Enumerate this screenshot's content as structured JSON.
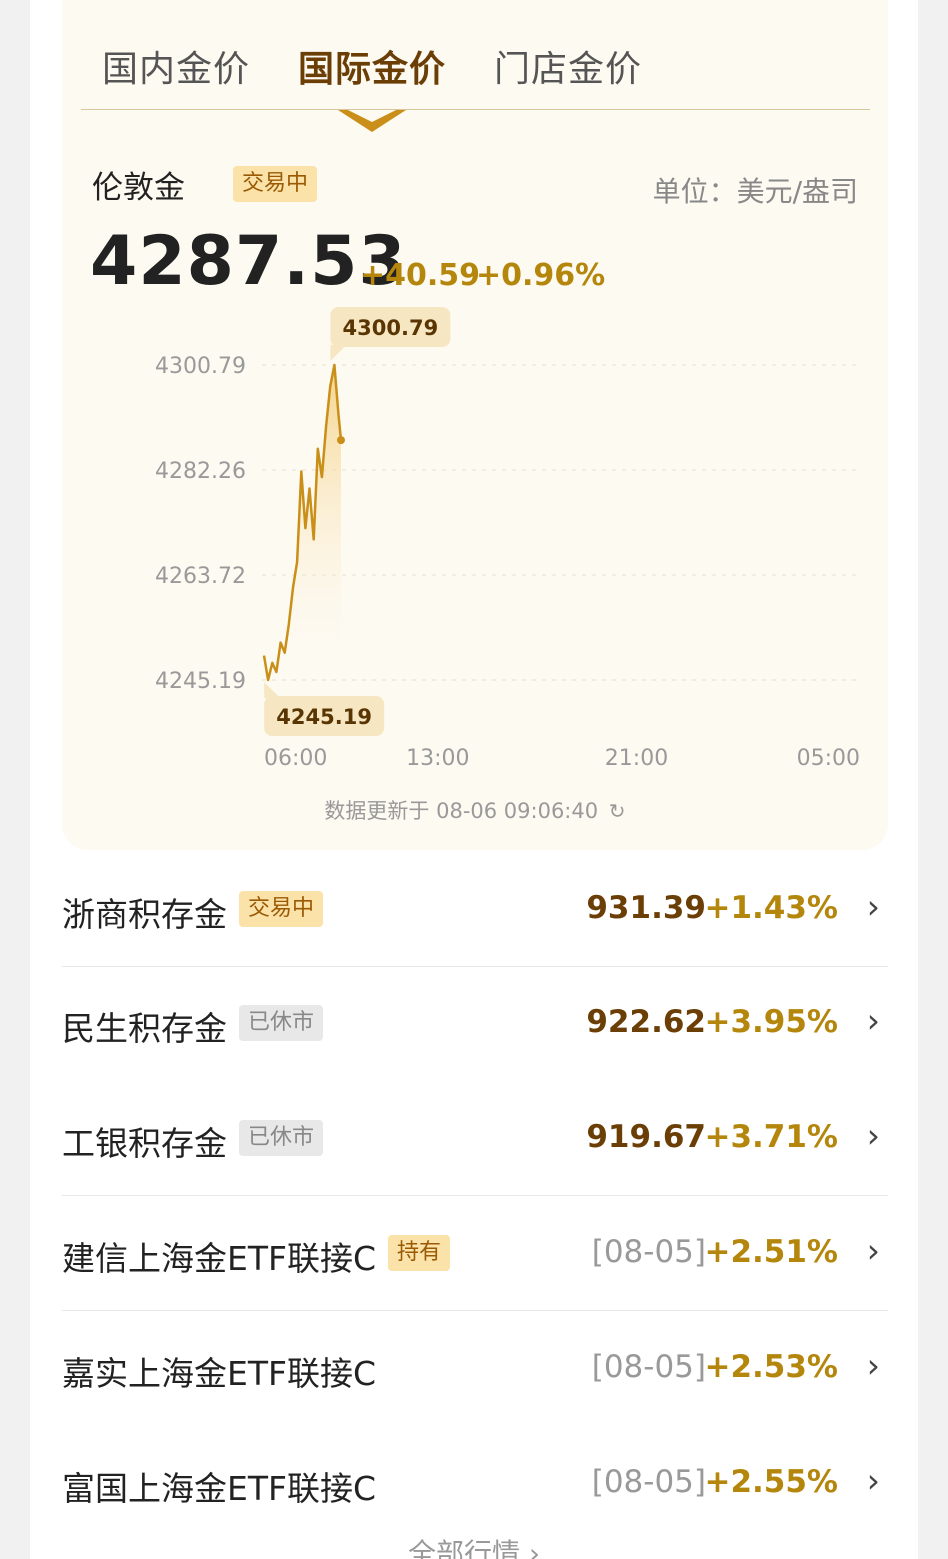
{
  "tabs": [
    {
      "label": "国内金价",
      "active": false
    },
    {
      "label": "国际金价",
      "active": true
    },
    {
      "label": "门店金价",
      "active": false
    }
  ],
  "asset": {
    "name": "伦敦金",
    "status": "交易中",
    "unit_label": "单位：美元/盎司",
    "price": "4287.53",
    "change": "+40.59",
    "change_pct": "+0.96%",
    "update_text": "数据更新于 08-06 09:06:40"
  },
  "colors": {
    "accent": "#c98f18",
    "up": "#b4860c",
    "brown": "#6b3e06"
  },
  "chart_data": {
    "type": "line",
    "series": [
      {
        "x": [
          "06:00",
          "06:10",
          "06:20",
          "06:30",
          "06:40",
          "06:50",
          "07:00",
          "07:10",
          "07:20",
          "07:30",
          "07:40",
          "07:50",
          "08:00",
          "08:10",
          "08:20",
          "08:30",
          "08:40",
          "08:50",
          "09:00",
          "09:06"
        ],
        "values": [
          4249.5,
          4245.19,
          4248.2,
          4246.6,
          4251.8,
          4250.0,
          4255.0,
          4261.5,
          4266.0,
          4282.0,
          4272.0,
          4279.0,
          4270.0,
          4286.0,
          4281.0,
          4290.0,
          4297.0,
          4300.79,
          4292.0,
          4287.53
        ]
      }
    ],
    "ylim": [
      4245.19,
      4300.79
    ],
    "y_ticks": [
      "4300.79",
      "4282.26",
      "4263.72",
      "4245.19"
    ],
    "x_ticks": [
      "06:00",
      "13:00",
      "21:00",
      "05:00"
    ],
    "max_label": "4300.79",
    "min_label": "4245.19",
    "grid": true
  },
  "rows": [
    {
      "name": "浙商积存金",
      "badge": "交易中",
      "badge_type": "trading",
      "value": "931.39",
      "value_is_date": false,
      "pct": "+1.43%",
      "divider": true
    },
    {
      "name": "民生积存金",
      "badge": "已休市",
      "badge_type": "closed",
      "value": "922.62",
      "value_is_date": false,
      "pct": "+3.95%",
      "divider": false
    },
    {
      "name": "工银积存金",
      "badge": "已休市",
      "badge_type": "closed",
      "value": "919.67",
      "value_is_date": false,
      "pct": "+3.71%",
      "divider": true
    },
    {
      "name": "建信上海金ETF联接C",
      "badge": "持有",
      "badge_type": "trading",
      "value": "[08-05]",
      "value_is_date": true,
      "pct": "+2.51%",
      "divider": true
    },
    {
      "name": "嘉实上海金ETF联接C",
      "badge": "",
      "badge_type": "",
      "value": "[08-05]",
      "value_is_date": true,
      "pct": "+2.53%",
      "divider": false
    },
    {
      "name": "富国上海金ETF联接C",
      "badge": "",
      "badge_type": "",
      "value": "[08-05]",
      "value_is_date": true,
      "pct": "+2.55%",
      "divider": false
    }
  ],
  "more_label": "全部行情 ›"
}
